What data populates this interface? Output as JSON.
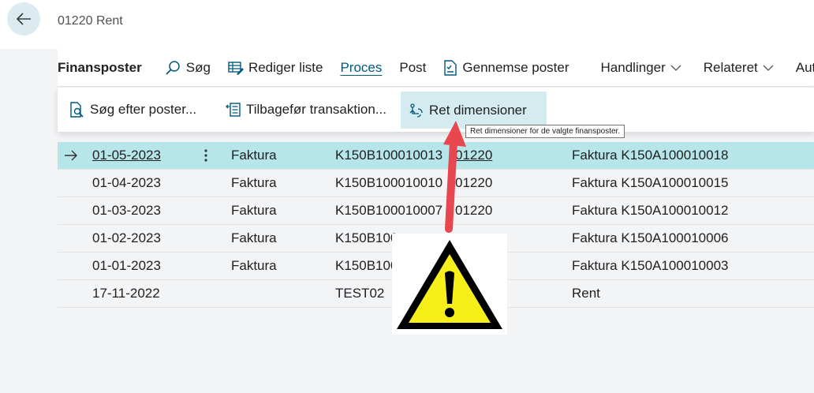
{
  "header": {
    "title": "01220 Rent"
  },
  "actionbar": {
    "items": [
      "Finansposter",
      "Søg",
      "Rediger liste",
      "Proces",
      "Post",
      "Gennemse poster",
      "Handlinger",
      "Relateret",
      "Aut"
    ]
  },
  "subactions": {
    "items": [
      "Søg efter poster...",
      "Tilbagefør transaktion...",
      "Ret dimensioner"
    ]
  },
  "tooltip": {
    "text": "Ret dimensioner for de valgte finansposter."
  },
  "table": {
    "rows": [
      {
        "date": "01-05-2023",
        "type": "Faktura",
        "doc": "K150B100010013",
        "account": "01220",
        "desc": "Faktura K150A100010018"
      },
      {
        "date": "01-04-2023",
        "type": "Faktura",
        "doc": "K150B100010010",
        "account": "01220",
        "desc": "Faktura K150A100010015"
      },
      {
        "date": "01-03-2023",
        "type": "Faktura",
        "doc": "K150B100010007",
        "account": "01220",
        "desc": "Faktura K150A100010012"
      },
      {
        "date": "01-02-2023",
        "type": "Faktura",
        "doc": "K150B100",
        "account": "",
        "desc": "Faktura K150A100010006"
      },
      {
        "date": "01-01-2023",
        "type": "Faktura",
        "doc": "K150B100",
        "account": "",
        "desc": "Faktura K150A100010003"
      },
      {
        "date": "17-11-2022",
        "type": "",
        "doc": "TEST02",
        "account": "",
        "desc": "Rent"
      }
    ]
  },
  "icons": {
    "back": "back-arrow-icon",
    "search": "search-icon",
    "edit_list": "edit-list-icon",
    "review": "review-entries-icon",
    "find_entries": "find-entries-icon",
    "reverse": "reverse-transaction-icon",
    "dimensions": "correct-dimensions-icon",
    "warning": "warning-icon"
  },
  "colors": {
    "accent": "#00587a",
    "selected_row": "#b6e6ea",
    "annotation_arrow": "#e8474f",
    "warning_yellow": "#f7ef1a"
  }
}
